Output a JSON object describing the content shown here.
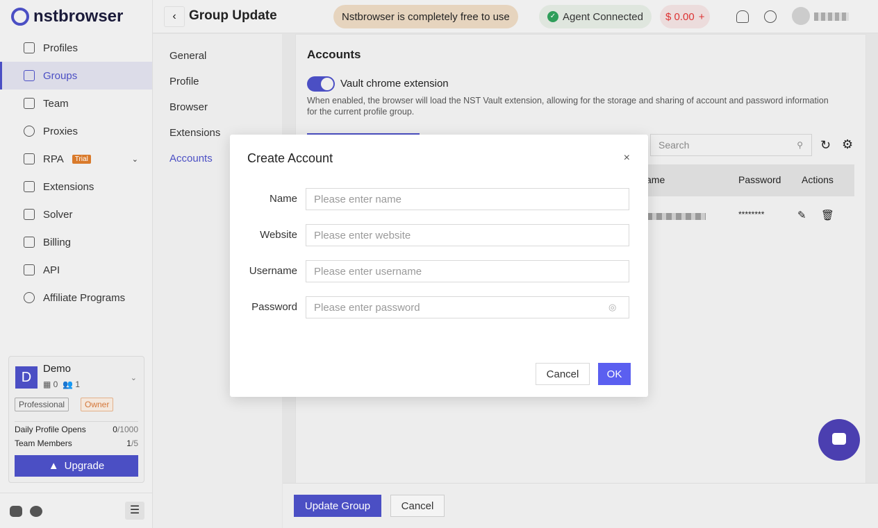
{
  "app": {
    "brand": "nstbrowser"
  },
  "sidebar": {
    "items": [
      {
        "label": "Profiles"
      },
      {
        "label": "Groups",
        "active": true
      },
      {
        "label": "Team"
      },
      {
        "label": "Proxies"
      },
      {
        "label": "RPA",
        "badge": "Trial"
      },
      {
        "label": "Extensions"
      },
      {
        "label": "Solver"
      },
      {
        "label": "Billing"
      },
      {
        "label": "API"
      },
      {
        "label": "Affiliate Programs"
      }
    ],
    "team": {
      "initial": "D",
      "name": "Demo",
      "groups": "0",
      "members": "1",
      "plan": "Professional",
      "role": "Owner",
      "daily_label": "Daily Profile Opens",
      "daily_used": "0",
      "daily_total": "/1000",
      "members_label": "Team Members",
      "members_used": "1",
      "members_total": "/5",
      "upgrade": "Upgrade"
    }
  },
  "header": {
    "title": "Group Update",
    "promo": "Nstbrowser is completely free to use",
    "agent": "Agent Connected",
    "balance": "$ 0.00",
    "add": "+"
  },
  "subnav": [
    "General",
    "Profile",
    "Browser",
    "Extensions",
    "Accounts"
  ],
  "content": {
    "title": "Accounts",
    "toggle_label": "Vault chrome extension",
    "toggle_on": true,
    "description": "When enabled, the browser will load the NST Vault extension, allowing for the storage and sharing of account and password information for the current profile group.",
    "search_placeholder": "Search",
    "columns": [
      "ame",
      "Password",
      "Actions"
    ],
    "row_password": "********"
  },
  "footer": {
    "update": "Update Group",
    "cancel": "Cancel"
  },
  "modal": {
    "title": "Create Account",
    "close": "×",
    "fields": [
      {
        "label": "Name",
        "placeholder": "Please enter name"
      },
      {
        "label": "Website",
        "placeholder": "Please enter website"
      },
      {
        "label": "Username",
        "placeholder": "Please enter username"
      },
      {
        "label": "Password",
        "placeholder": "Please enter password"
      }
    ],
    "cancel": "Cancel",
    "ok": "OK"
  },
  "colors": {
    "accent": "#4b4fc4",
    "success": "#2f9e5a",
    "danger": "#dd3333"
  }
}
